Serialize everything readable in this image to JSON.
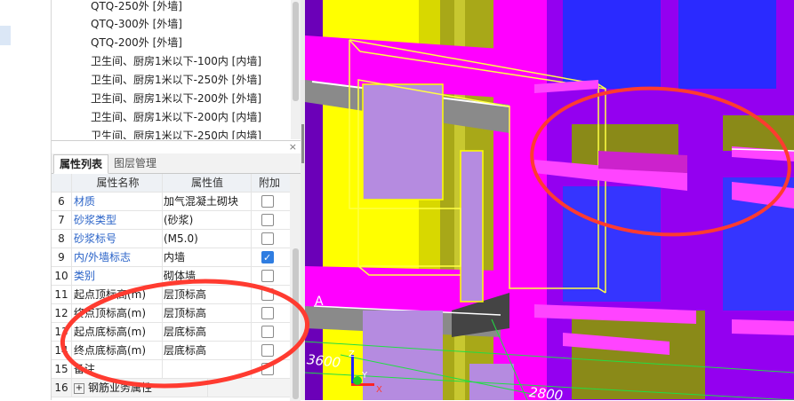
{
  "tree": {
    "items": [
      "QTQ-250外 [外墙]",
      "QTQ-300外 [外墙]",
      "QTQ-200外 [外墙]",
      "卫生间、厨房1米以下-100内 [内墙]",
      "卫生间、厨房1米以下-250外 [外墙]",
      "卫生间、厨房1米以下-200外 [外墙]",
      "卫生间、厨房1米以下-200内 [内墙]",
      "卫生间、厨房1米以下-250内 [内墙]"
    ]
  },
  "props": {
    "close_glyph": "×",
    "tabs": [
      "属性列表",
      "图层管理"
    ],
    "headers": {
      "num": "",
      "name": "属性名称",
      "value": "属性值",
      "add": "附加"
    },
    "rows": [
      {
        "num": "6",
        "name": "材质",
        "value": "加气混凝土砌块",
        "checked": false
      },
      {
        "num": "7",
        "name": "砂浆类型",
        "value": "(砂浆)",
        "checked": false
      },
      {
        "num": "8",
        "name": "砂浆标号",
        "value": "(M5.0)",
        "checked": false
      },
      {
        "num": "9",
        "name": "内/外墙标志",
        "value": "内墙",
        "checked": true
      },
      {
        "num": "10",
        "name": "类别",
        "value": "砌体墙",
        "checked": false
      },
      {
        "num": "11",
        "name": "起点顶标高(m)",
        "value": "层顶标高",
        "checked": false
      },
      {
        "num": "12",
        "name": "终点顶标高(m)",
        "value": "层顶标高",
        "checked": false
      },
      {
        "num": "13",
        "name": "起点底标高(m)",
        "value": "层底标高",
        "checked": false
      },
      {
        "num": "14",
        "name": "终点底标高(m)",
        "value": "层底标高",
        "checked": false
      },
      {
        "num": "15",
        "name": "备注",
        "value": "",
        "checked": false
      },
      {
        "num": "16",
        "name": "钢筋业务属性",
        "value": "",
        "checked": null
      }
    ]
  },
  "viewport": {
    "axis_label": "A",
    "dim_1": "3600",
    "dim_2": "2800",
    "axis_z": "Z",
    "axis_y": "Y",
    "axis_x": "X"
  },
  "colors": {
    "wall_magenta": "#ff00ff",
    "wall_purple": "#9b00ff",
    "column_yellow": "#ffff00",
    "olive": "#9a9a10",
    "glass_blue": "#3a3aff",
    "annotation_red": "#ff3b30",
    "checkbox_blue": "#2f7de1",
    "link_blue": "#2a63c8"
  }
}
